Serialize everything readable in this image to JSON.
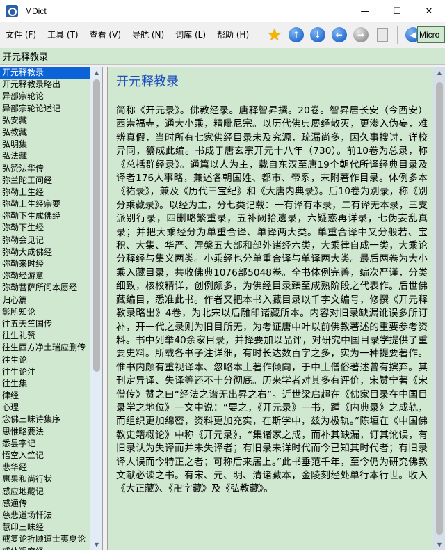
{
  "window": {
    "title": "MDict",
    "minimize": "—",
    "maximize": "☐",
    "close": "✕"
  },
  "menu": [
    {
      "label": "文件 (F)",
      "name": "menu-file"
    },
    {
      "label": "工具 (T)",
      "name": "menu-tools"
    },
    {
      "label": "查看 (V)",
      "name": "menu-view"
    },
    {
      "label": "导航 (N)",
      "name": "menu-navigate"
    },
    {
      "label": "词库 (L)",
      "name": "menu-library"
    },
    {
      "label": "帮助 (H)",
      "name": "menu-help"
    }
  ],
  "toolbar": {
    "dictionary_selector": "Micro"
  },
  "search": {
    "value": "开元释教录"
  },
  "word_list": {
    "selected_index": 0,
    "items": [
      "开元释教录",
      "开元释教录略出",
      "异部宗轮论",
      "异部宗轮论述记",
      "弘安藏",
      "弘教藏",
      "弘明集",
      "弘法藏",
      "弘赞法华传",
      "弥兰陀王问经",
      "弥勒上生经",
      "弥勒上生经宗要",
      "弥勒下生成佛经",
      "弥勒下生经",
      "弥勒会见记",
      "弥勒大成佛经",
      "弥勒来时经",
      "弥勒经游意",
      "弥勒菩萨所问本愿经",
      "归心篇",
      "彰所知论",
      "往五天竺国传",
      "往生礼赞",
      "往生西方净土瑞应删传",
      "往生论",
      "往生论注",
      "往生集",
      "律经",
      "心理",
      "念佛三昧诗集序",
      "思惟略要法",
      "悉昙字记",
      "悟空入竺记",
      "悲华经",
      "惠果和尚行状",
      "感应地藏记",
      "感通传",
      "慈悲道场忏法",
      "慧印三昧经",
      "戒复论折顾道士夷夏论",
      "戒体羯磨经"
    ]
  },
  "entry": {
    "title": "开元释教录",
    "body": "简称《开元录》。佛教经录。唐释智昇撰。20卷。智昇居长安（今西安）西崇福寺，通大小乘，精毗尼宗。以历代佛典屡经散灭，更渗入伪妄，难辨真假，当时所有七家佛经目录未及究源，疏漏尚多，因久事搜讨，详校异同，纂成此编。书成于唐玄宗开元十八年（730）。前10卷为总录，称《总括群经录》。通篇以人为主，载自东汉至唐19个朝代所译经典目录及译者176人事略，兼述各朝国姓、都市、帝系，末附著作目录。体例多本《祐录》，兼及《历代三宝纪》和《大唐内典录》。后10卷为别录，称《别分乘藏录》。以经为主，分七类记载：一有译有本录，二有译无本录，三支派别行录，四删略繁重录，五补阙拾遗录，六疑惑再详录，七伪妄乱真录；并把大乘经分为单重合译、单译两大类。单重合译中又分般若、宝积、大集、华严、涅槃五大部和部外诸经六类，大乘律自成一类，大乘论分释经与集义两类。小乘经也分单重合译与单译两大类。最后两卷为大小乘入藏目录，共收佛典1076部5048卷。全书体例完善，编次严谨，分类细致，核校精详，创例颇多，为佛经目录臻至成熟阶段之代表作。后世佛藏编目，悉准此书。作者又把本书入藏目录以千字文编号，修撰《开元释教录略出》4卷，为北宋以后雕印诸藏所本。内容对旧录缺漏讹误多所订补，开一代之录则为旧目所无，为考证唐中叶以前佛教著述的重要参考资料。书中列举40余家目录，并择要加以品评，对研究中国目录学提供了重要史料。所载各书子注详细，有时长达数百字之多，实为一种提要著作。惟书内颇有重视译本、忽略本土著作倾向，于中土僧俗著述曾有摈弃。其刊定异译、失译等还不十分彻底。历来学者对其多有评价，宋赞宁著《宋僧传》赞之曰“经法之谱无出昇之右”。近世梁启超在《佛家目录在中国目录学之地位》一文中说：“要之，《开元录》一书，踵《内典录》之成轨，而组织更加绵密，资料更加充实，在斯学中，兹为极轨。”陈垣在《中国佛教史籍概论》中称《开元录》，“集诸家之成，而补其缺漏，订其讹误，有旧录认为失译而并未失译者；有旧录未详时代而今已知其时代者；有旧录译人误而今特正之者；可称后来居上。”此书垂范千年，至今仍为研究佛教文献必读之书。有宋、元、明、清诸藏本，金陵刻经处单行本行世。收入《大正藏》、《卍字藏》及《弘教藏》。"
  }
}
